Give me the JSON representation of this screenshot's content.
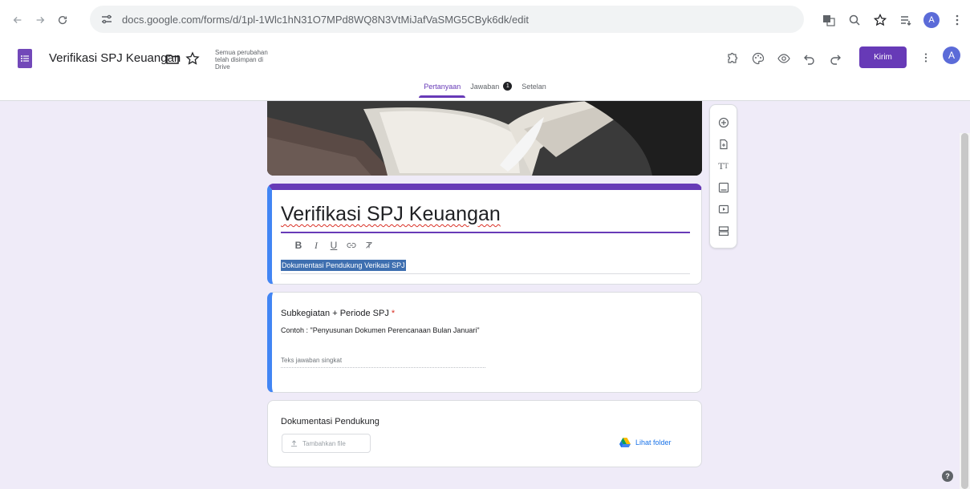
{
  "browser": {
    "url": "docs.google.com/forms/d/1pl-1Wlc1hN31O7MPd8WQ8N3VtMiJafVaSMG5CByk6dk/edit",
    "profile_initial": "A"
  },
  "header": {
    "doc_title": "Verifikasi SPJ Keuangan",
    "save_status": "Semua perubahan telah disimpan di Drive",
    "send_label": "Kirim",
    "avatar_initial": "A"
  },
  "tabs": [
    {
      "label": "Pertanyaan",
      "active": true
    },
    {
      "label": "Jawaban",
      "badge": "1"
    },
    {
      "label": "Setelan"
    }
  ],
  "form": {
    "title": "Verifikasi SPJ Keuangan",
    "format_labels": {
      "bold": "B",
      "italic": "I",
      "underline": "U"
    },
    "description": "Dokumentasi Pendukung Verikasi SPJ"
  },
  "question": {
    "title": "Subkegiatan + Periode SPJ",
    "required_mark": "*",
    "description": "Contoh : \"Penyusunan Dokumen Perencanaan Bulan Januari\"",
    "answer_placeholder": "Teks jawaban singkat"
  },
  "file_question": {
    "title": "Dokumentasi Pendukung",
    "add_file_label": "Tambahkan file",
    "view_folder_label": "Lihat folder"
  },
  "side_toolbar": [
    "add-question",
    "import-questions",
    "add-title",
    "add-image",
    "add-video",
    "add-section"
  ],
  "colors": {
    "accent": "#673ab7",
    "focus": "#4285f4",
    "background": "#efebf8",
    "link": "#1a73e8"
  }
}
